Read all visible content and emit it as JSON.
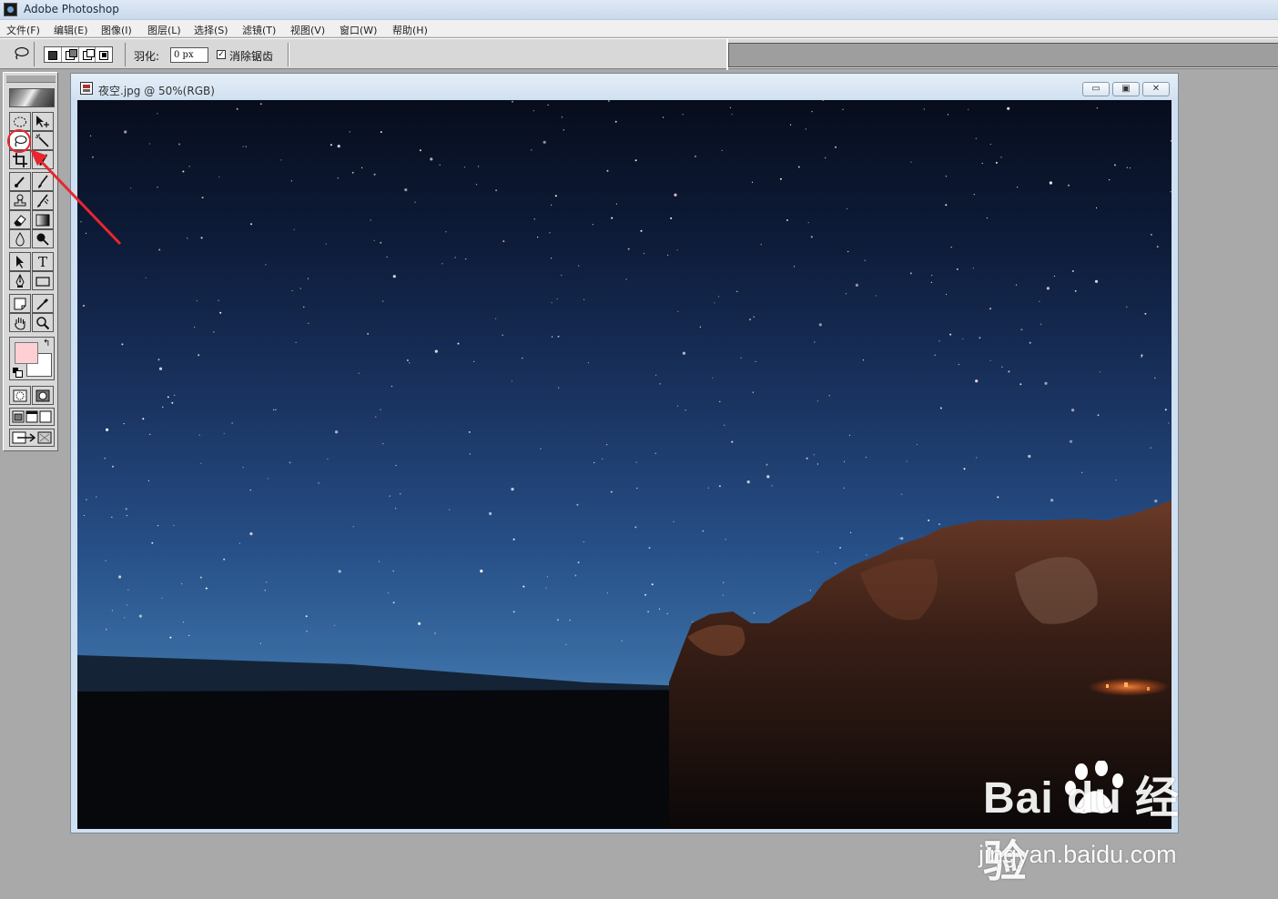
{
  "app": {
    "title": "Adobe Photoshop"
  },
  "menubar": {
    "items": [
      "文件(F)",
      "编辑(E)",
      "图像(I)",
      "图层(L)",
      "选择(S)",
      "滤镜(T)",
      "视图(V)",
      "窗口(W)",
      "帮助(H)"
    ]
  },
  "options": {
    "feather_label": "羽化:",
    "feather_value": "0 px",
    "antialias_label": "消除锯齿",
    "antialias_checked": true,
    "selection_modes": [
      "new-selection",
      "add-to-selection",
      "subtract-from-selection",
      "intersect-selection"
    ]
  },
  "toolbox": {
    "foreground_color": "#ffcfd3",
    "background_color": "#ffffff",
    "active_tool": "lasso",
    "tools": [
      "marquee-icon",
      "move-icon",
      "lasso-icon",
      "magic-wand-icon",
      "crop-icon",
      "slice-icon",
      "healing-brush-icon",
      "brush-icon",
      "clone-stamp-icon",
      "history-brush-icon",
      "eraser-icon",
      "gradient-icon",
      "blur-icon",
      "dodge-icon",
      "path-selection-icon",
      "type-icon",
      "pen-icon",
      "rectangle-icon",
      "notes-icon",
      "eyedropper-icon",
      "hand-icon",
      "zoom-icon"
    ],
    "type_tool_glyph": "T",
    "swap_glyph": "↰"
  },
  "annotation": {
    "highlight_color": "#e8262d"
  },
  "document": {
    "title": "夜空.jpg @ 50%(RGB)",
    "zoom": "50%",
    "mode": "RGB"
  },
  "window_buttons": {
    "minimize": "▭",
    "maximize": "▣",
    "close": "✕"
  },
  "watermark": {
    "brand": "Bai du 经验",
    "url": "jingyan.baidu.com"
  }
}
